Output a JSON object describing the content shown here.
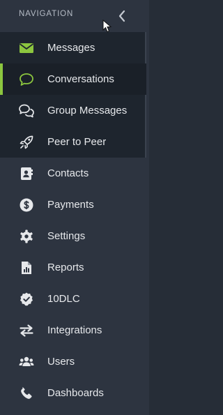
{
  "nav": {
    "title": "NAVIGATION",
    "collapse_icon": "chevron-left-icon"
  },
  "menu": [
    {
      "label": "Messages",
      "icon": "envelope-icon"
    },
    {
      "label": "Conversations",
      "icon": "speech-bubble-icon",
      "active": true
    },
    {
      "label": "Group Messages",
      "icon": "chat-bubbles-icon"
    },
    {
      "label": "Peer to Peer",
      "icon": "rocket-icon"
    },
    {
      "label": "Contacts",
      "icon": "address-book-icon"
    },
    {
      "label": "Payments",
      "icon": "dollar-circle-icon"
    },
    {
      "label": "Settings",
      "icon": "gear-icon"
    },
    {
      "label": "Reports",
      "icon": "report-chart-icon"
    },
    {
      "label": "10DLC",
      "icon": "badge-check-icon"
    },
    {
      "label": "Integrations",
      "icon": "arrows-swap-icon"
    },
    {
      "label": "Users",
      "icon": "users-icon"
    },
    {
      "label": "Dashboards",
      "icon": "phone-icon"
    }
  ],
  "colors": {
    "accent": "#8cc63f",
    "text": "#e6e8eb",
    "background": "#2d3440"
  }
}
